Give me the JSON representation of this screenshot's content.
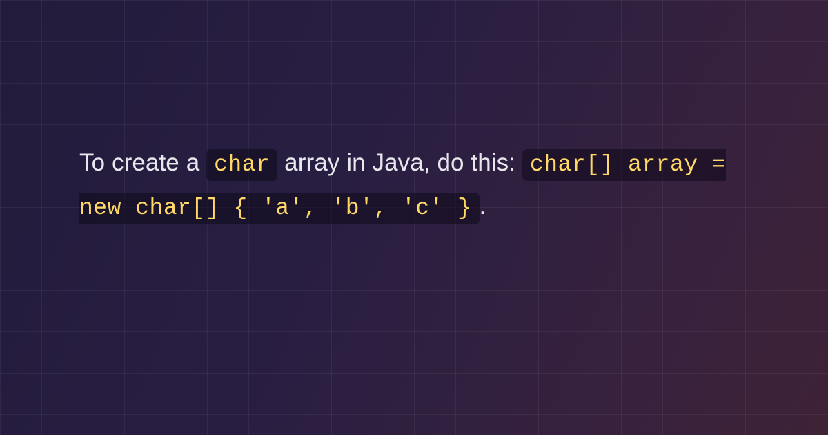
{
  "text": {
    "part1": "To create a ",
    "code1": "char",
    "part2": " array in Java, do this: ",
    "code2": "char[] array = new char[] { 'a', 'b', 'c' }",
    "part3": "."
  },
  "colors": {
    "code_text": "#ffd866",
    "body_text": "#e8e7ee",
    "code_bg": "rgba(15,10,25,0.55)"
  }
}
